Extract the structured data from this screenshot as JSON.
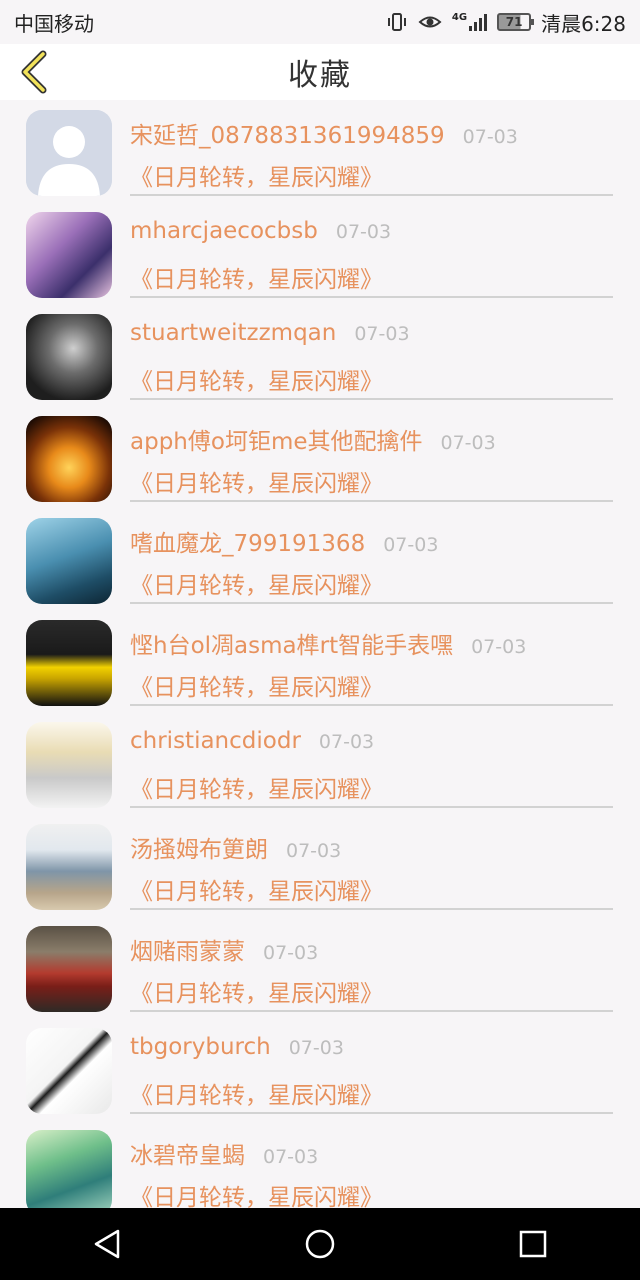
{
  "statusbar": {
    "carrier": "中国移动",
    "network": "4G",
    "battery": "71",
    "time": "清晨6:28"
  },
  "header": {
    "title": "收藏",
    "back_icon": "chevron-left-icon",
    "accent": "#e7925e"
  },
  "items": [
    {
      "name": "宋延哲_0878831361994859",
      "date": "07-03",
      "content": "《日月轮转，星辰闪耀》"
    },
    {
      "name": "mharcjaecocbsb",
      "date": "07-03",
      "content": "《日月轮转，星辰闪耀》"
    },
    {
      "name": "stuartweitzzmqan",
      "date": "07-03",
      "content": "《日月轮转，星辰闪耀》"
    },
    {
      "name": "apph傅o坷钜me其他配擒件",
      "date": "07-03",
      "content": "《日月轮转，星辰闪耀》"
    },
    {
      "name": "嗜血魔龙_799191368",
      "date": "07-03",
      "content": "《日月轮转，星辰闪耀》"
    },
    {
      "name": "悭h台ol凋asma榫rt智能手表嘿",
      "date": "07-03",
      "content": "《日月轮转，星辰闪耀》"
    },
    {
      "name": "christiancdiodr",
      "date": "07-03",
      "content": "《日月轮转，星辰闪耀》"
    },
    {
      "name": "汤搔姆布筻朗",
      "date": "07-03",
      "content": "《日月轮转，星辰闪耀》"
    },
    {
      "name": "烟赌雨蒙蒙",
      "date": "07-03",
      "content": "《日月轮转，星辰闪耀》"
    },
    {
      "name": "tbgoryburch",
      "date": "07-03",
      "content": "《日月轮转，星辰闪耀》"
    },
    {
      "name": "冰碧帝皇蝎",
      "date": "07-03",
      "content": "《日月轮转，星辰闪耀》"
    }
  ],
  "system_nav": {
    "back": "triangle-back-icon",
    "home": "circle-home-icon",
    "recents": "square-recents-icon"
  }
}
